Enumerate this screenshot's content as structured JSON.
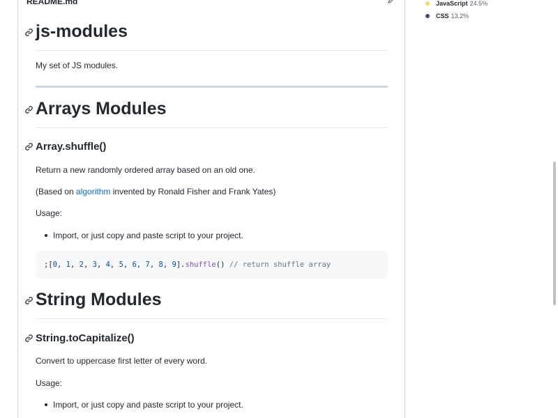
{
  "readme": {
    "filename": "README.md",
    "title": "js-modules",
    "description": "My set of JS modules.",
    "arrays_heading": "Arrays Modules",
    "shuffle_heading": "Array.shuffle()",
    "shuffle_desc": "Return a new randomly ordered array based on an old one.",
    "based_on_prefix": "(Based on ",
    "based_on_link": "algorithm",
    "based_on_suffix": " invented by Ronald Fisher and Frank Yates)",
    "usage1": "Usage:",
    "usage1_item": "Import, or just copy and paste script to your project.",
    "code_prefix": ";[",
    "code_numbers": [
      "0",
      "1",
      "2",
      "3",
      "4",
      "5",
      "6",
      "7",
      "8",
      "9"
    ],
    "code_close": "].",
    "code_fn": "shuffle",
    "code_call": "() ",
    "code_comment": "// return shuffle array",
    "string_heading": "String Modules",
    "capitalize_heading": "String.toCapitalize()",
    "capitalize_desc": "Convert to uppercase first letter of every word.",
    "usage2": "Usage:",
    "usage2_item": "Import, or just copy and paste script to your project."
  },
  "languages": [
    {
      "name": "JavaScript",
      "percent": "24.5%",
      "color": "#f1e05a"
    },
    {
      "name": "CSS",
      "percent": "13.2%",
      "color": "#563d7c"
    }
  ]
}
